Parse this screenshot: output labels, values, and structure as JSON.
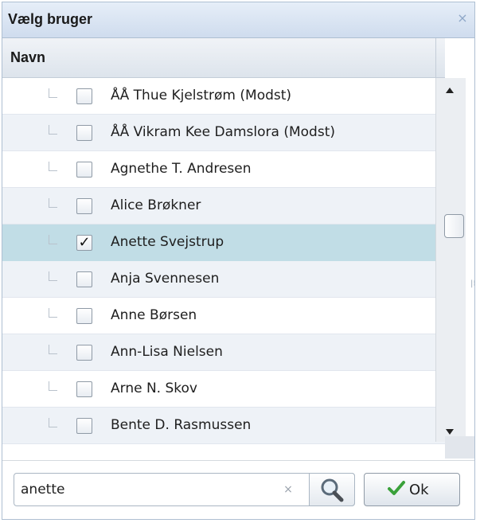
{
  "dialog": {
    "title": "Vælg bruger",
    "close_glyph": "×"
  },
  "grid": {
    "column_header": "Navn",
    "rows": [
      {
        "name": "ÅÅ Thue Kjelstrøm (Modst)",
        "checked": false,
        "selected": false
      },
      {
        "name": "ÅÅ Vikram Kee  Damslora (Modst)",
        "checked": false,
        "selected": false
      },
      {
        "name": "Agnethe T. Andresen",
        "checked": false,
        "selected": false
      },
      {
        "name": "Alice Brøkner",
        "checked": false,
        "selected": false
      },
      {
        "name": "Anette Svejstrup",
        "checked": true,
        "selected": true
      },
      {
        "name": "Anja Svennesen",
        "checked": false,
        "selected": false
      },
      {
        "name": "Anne Børsen",
        "checked": false,
        "selected": false
      },
      {
        "name": "Ann-Lisa Nielsen",
        "checked": false,
        "selected": false
      },
      {
        "name": "Arne N. Skov",
        "checked": false,
        "selected": false
      },
      {
        "name": "Bente D. Rasmussen",
        "checked": false,
        "selected": false
      }
    ],
    "check_glyph": "✓"
  },
  "search": {
    "value": "anette",
    "clear_glyph": "×",
    "icon": "magnifier-icon"
  },
  "ok_button": {
    "label": "Ok",
    "icon": "check-icon",
    "icon_color": "#3aa13a"
  },
  "colors": {
    "selected_row": "#c1dde6",
    "alt_row": "#eef2f7",
    "titlebar": "#cfdcee"
  }
}
